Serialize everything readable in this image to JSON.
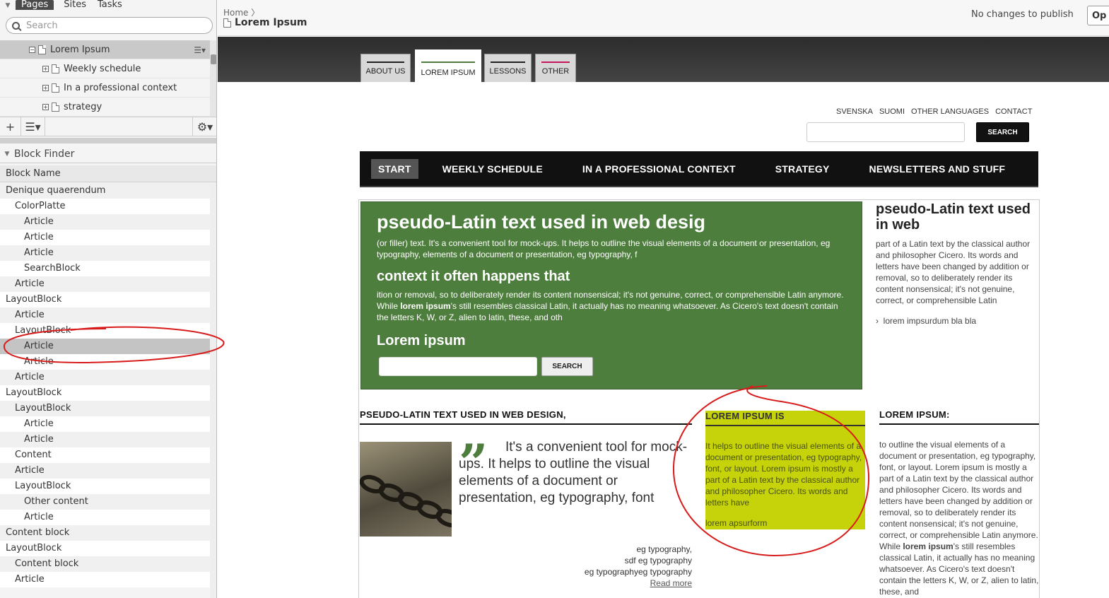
{
  "left_panel": {
    "tabs": [
      "Pages",
      "Sites",
      "Tasks"
    ],
    "search_placeholder": "Search",
    "tree": [
      {
        "label": "Lorem Ipsum",
        "level": 1,
        "selected": true,
        "toggle": "−"
      },
      {
        "label": "Weekly schedule",
        "level": 2,
        "toggle": "+"
      },
      {
        "label": "In a professional context",
        "level": 2,
        "toggle": "+"
      },
      {
        "label": "strategy",
        "level": 2,
        "toggle": "+"
      }
    ],
    "block_finder": {
      "title": "Block Finder",
      "column": "Block Name",
      "items": [
        {
          "label": "Denique quaerendum",
          "level": 0
        },
        {
          "label": "ColorPlatte",
          "level": 1
        },
        {
          "label": "Article",
          "level": 2
        },
        {
          "label": "Article",
          "level": 2
        },
        {
          "label": "Article",
          "level": 2
        },
        {
          "label": "SearchBlock",
          "level": 2
        },
        {
          "label": "Article",
          "level": 1
        },
        {
          "label": "LayoutBlock",
          "level": 0
        },
        {
          "label": "Article",
          "level": 1
        },
        {
          "label": "LayoutBlock",
          "level": 1
        },
        {
          "label": "Article",
          "level": 2,
          "highlighted": true
        },
        {
          "label": "Article",
          "level": 2
        },
        {
          "label": "Article",
          "level": 1
        },
        {
          "label": "LayoutBlock",
          "level": 0
        },
        {
          "label": "LayoutBlock",
          "level": 1
        },
        {
          "label": "Article",
          "level": 2
        },
        {
          "label": "Article",
          "level": 2
        },
        {
          "label": "Content",
          "level": 1
        },
        {
          "label": "Article",
          "level": 1
        },
        {
          "label": "LayoutBlock",
          "level": 1
        },
        {
          "label": "Other content",
          "level": 2
        },
        {
          "label": "Article",
          "level": 2
        },
        {
          "label": "Content block",
          "level": 0
        },
        {
          "label": "LayoutBlock",
          "level": 0
        },
        {
          "label": "Content block",
          "level": 1
        },
        {
          "label": "Article",
          "level": 1
        }
      ]
    }
  },
  "header": {
    "breadcrumb": "Home",
    "breadcrumb_sep": "〉",
    "page_title": "Lorem Ipsum",
    "status": "No changes to publish",
    "options_button": "Op"
  },
  "page_tabs": [
    {
      "label": "ABOUT US",
      "color": "#222222"
    },
    {
      "label": "LOREM IPSUM",
      "color": "#4e7e3d",
      "active": true
    },
    {
      "label": "LESSONS",
      "color": "#222222"
    },
    {
      "label": "OTHER",
      "color": "#c2185b"
    }
  ],
  "site": {
    "languages": [
      "SVENSKA",
      "SUOMI",
      "OTHER LANGUAGES",
      "CONTACT"
    ],
    "search_button": "SEARCH",
    "menu": [
      "START",
      "WEEKLY SCHEDULE",
      "IN A PROFESSIONAL CONTEXT",
      "STRATEGY",
      "NEWSLETTERS AND STUFF"
    ],
    "hero": {
      "title": "pseudo-Latin text used in web desig",
      "para1": "(or filler) text. It's a convenient tool for mock-ups. It helps to outline the visual elements of a document or presentation, eg typography, elements of a document or presentation, eg typography, f",
      "subtitle": "context it often happens that",
      "para2_a": "ition or removal, so to deliberately render its content nonsensical; it's not genuine, correct, or comprehensible Latin anymore. While ",
      "para2_bold": "lorem ipsum",
      "para2_b": "'s still resembles classical Latin, it actually has no meaning whatsoever. As Cicero's text doesn't contain the letters K, W, or Z, alien to latin, these, and oth",
      "search_title": "Lorem ipsum",
      "search_button": "SEARCH"
    },
    "sidebar": {
      "title": "pseudo-Latin text used in web",
      "text": " part of a Latin text by the classical author and philosopher Cicero. Its words and letters have been changed by addition or removal, so to deliberately render its content nonsensical; it's not genuine, correct, or comprehensible Latin",
      "link_arrow": "›",
      "link": "lorem impsurdum bla bla"
    },
    "col1": {
      "heading": "PSEUDO-LATIN TEXT USED IN WEB DESIGN,",
      "quote_mark": "”",
      "quote": "It's a convenient tool for mock-ups. It helps to outline the visual elements of a document or presentation, eg typography, font",
      "tag1": "eg typography,",
      "tag2": "sdf eg typography",
      "tag3": "eg typographyeg typography",
      "read_more": "Read more"
    },
    "col2": {
      "heading": "LOREM IPSUM IS",
      "text": "It helps to outline the visual elements of a document or presentation, eg typography, font, or layout. Lorem ipsum is mostly a part of a Latin text by the classical author and philosopher Cicero. Its words and letters have",
      "footer": "lorem apsurform",
      "bg": "#c6d30a"
    },
    "col3": {
      "heading": "LOREM IPSUM:",
      "text_a": "to outline the visual elements of a document or presentation, eg typography, font, or layout. Lorem ipsum is mostly a part of a Latin text by the classical author and philosopher Cicero. Its words and letters have been changed by addition or removal, so to deliberately render its content nonsensical; it's not genuine, correct, or comprehensible Latin anymore. While ",
      "text_bold": "lorem ipsum",
      "text_b": "'s still resembles classical Latin, it actually has no meaning whatsoever. As Cicero's text doesn't contain the letters K, W, or Z, alien to latin, these, and"
    }
  },
  "colors": {
    "accent_green": "#4e7e3d",
    "annotation_red": "#d81b1b"
  }
}
